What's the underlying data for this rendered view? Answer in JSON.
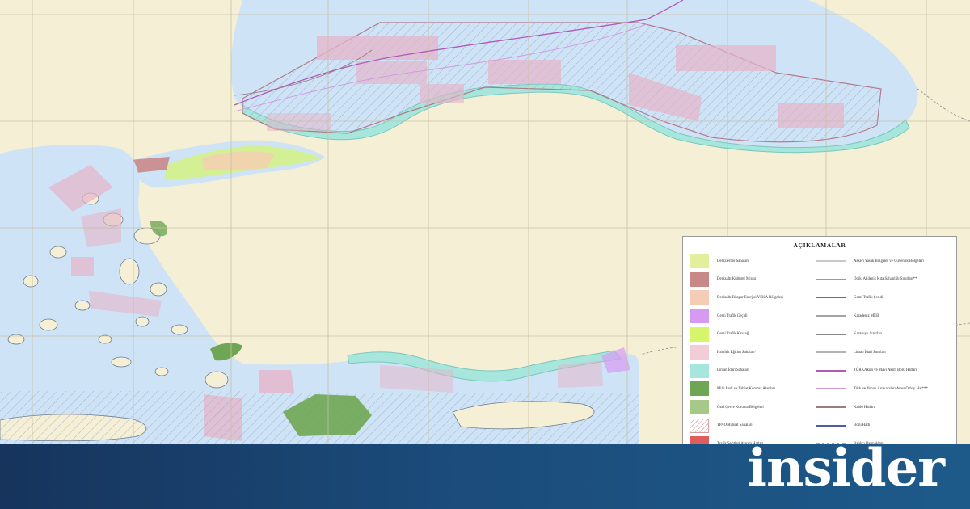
{
  "legend": {
    "title": "AÇIKLAMALAR",
    "left_items": [
      {
        "label": "Denizlerme Sahaları",
        "color": "#e3ef9a"
      },
      {
        "label": "Denizaltı Kültürel Mirası",
        "color": "#c98888"
      },
      {
        "label": "Denizaltı Rüzgar Enerjisi YEKA Bölgeleri",
        "color": "#f5cdb4"
      },
      {
        "label": "Gemi Trafik Geçidi",
        "color": "#d79af2"
      },
      {
        "label": "Gemi Trafik Kavşağı",
        "color": "#d6f56a"
      },
      {
        "label": "Hamlelı Eğitim Sahaları*",
        "color": "#f2ccd6"
      },
      {
        "label": "Liman İdari Sahaları",
        "color": "#a6e6dc"
      },
      {
        "label": "Milli Park ve Tabiat Koruma Alanları",
        "color": "#6fa653"
      },
      {
        "label": "Özel Çevre Koruma Bölgeleri",
        "color": "#a7c987"
      },
      {
        "label": "TPAO Ruhsat Sahaları",
        "color": "hatch"
      },
      {
        "label": "Trafik Şeritleri Ayırım Hatları",
        "color": "#de5e5e"
      }
    ],
    "right_items": [
      {
        "label": "Askeri Yasak Bölgeler ve Güvenlik Bölgeleri",
        "color": "#c9c9c9"
      },
      {
        "label": "Doğu Akdeniz Kıta Sahanlığı Sınırları**",
        "color": "#9a9a9a"
      },
      {
        "label": "Gemi Trafik Şeridi",
        "color": "#6f6f6f"
      },
      {
        "label": "Karadeniz MEB",
        "color": "#a3a3a3"
      },
      {
        "label": "Karasuyu Sınırları",
        "color": "#8a8a8a"
      },
      {
        "label": "Liman İdari Sınırları",
        "color": "#b4b4b4"
      },
      {
        "label": "TÜRKAkım ve Mavi Akım Boru Hatları",
        "color": "#b05ab8"
      },
      {
        "label": "Türk ve Yunan Anakaraları Arası Orbay Hat***",
        "color": "#d49ae0"
      },
      {
        "label": "Kablo Hatları",
        "color": "#9b7d7d"
      },
      {
        "label": "Boru Hattı",
        "color": "#4c5ea8"
      },
      {
        "label": "Balıkçı Barınakları",
        "color": "#6ad06a"
      }
    ]
  },
  "brand": {
    "name": "insider"
  },
  "colors": {
    "sea": "#cfe3f7",
    "land": "#f5efd6",
    "coast_zone": "#a6e6dc",
    "training_zone": "#e5b4c8",
    "banner": "#1b4b7a"
  },
  "map_symbols": [
    "sea-area",
    "land-area",
    "hatched-license-areas",
    "pipeline-routes",
    "coastal-zones",
    "grid-lines"
  ]
}
